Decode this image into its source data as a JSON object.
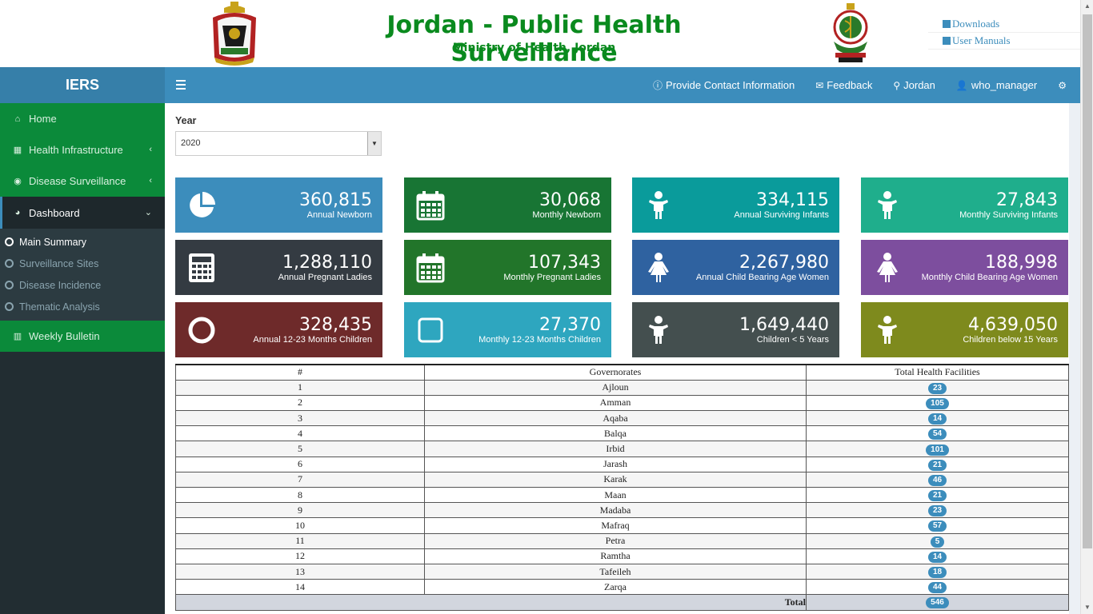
{
  "header": {
    "title": "Jordan - Public Health Surveillance",
    "subtitle": "Ministry of Health, Jordan",
    "links": [
      "Downloads",
      "User Manuals"
    ]
  },
  "brand": "IERS",
  "navbar": {
    "items": [
      {
        "icon": "info-icon",
        "label": "Provide Contact Information"
      },
      {
        "icon": "envelope-icon",
        "label": "Feedback"
      },
      {
        "icon": "map-marker-icon",
        "label": "Jordan"
      },
      {
        "icon": "user-icon",
        "label": "who_manager"
      }
    ]
  },
  "sidebar": {
    "items": [
      {
        "label": "Home",
        "icon": "home-icon"
      },
      {
        "label": "Health Infrastructure",
        "icon": "grid-icon"
      },
      {
        "label": "Disease Surveillance",
        "icon": "eye-icon"
      },
      {
        "label": "Dashboard",
        "icon": "pie-chart-icon"
      },
      {
        "label": "Weekly Bulletin",
        "icon": "bar-chart-icon"
      }
    ],
    "submenu": [
      "Main Summary",
      "Surveillance Sites",
      "Disease Incidence",
      "Thematic Analysis"
    ]
  },
  "filter": {
    "label": "Year",
    "selected": "2020"
  },
  "tiles": [
    {
      "value": "360,815",
      "label": "Annual Newborn",
      "color": "#3c8dbc",
      "icon": "pie-chart-icon"
    },
    {
      "value": "30,068",
      "label": "Monthly Newborn",
      "color": "#187534",
      "icon": "calendar-icon"
    },
    {
      "value": "334,115",
      "label": "Annual Surviving Infants",
      "color": "#0a9b9b",
      "icon": "child-icon"
    },
    {
      "value": "27,843",
      "label": "Monthly Surviving Infants",
      "color": "#1fae8c",
      "icon": "child-icon"
    },
    {
      "value": "1,288,110",
      "label": "Annual Pregnant Ladies",
      "color": "#343b42",
      "icon": "calculator-icon"
    },
    {
      "value": "107,343",
      "label": "Monthly Pregnant Ladies",
      "color": "#22752a",
      "icon": "calendar-icon"
    },
    {
      "value": "2,267,980",
      "label": "Annual Child Bearing Age Women",
      "color": "#2f62a0",
      "icon": "female-icon"
    },
    {
      "value": "188,998",
      "label": "Monthly Child Bearing Age Women",
      "color": "#7d4e9e",
      "icon": "female-icon"
    },
    {
      "value": "328,435",
      "label": "Annual 12-23 Months Children",
      "color": "#6e2a2a",
      "icon": "circle-icon"
    },
    {
      "value": "27,370",
      "label": "Monthly 12-23 Months Children",
      "color": "#2ea6bf",
      "icon": "square-icon"
    },
    {
      "value": "1,649,440",
      "label": "Children < 5 Years",
      "color": "#444f4f",
      "icon": "child-icon"
    },
    {
      "value": "4,639,050",
      "label": "Children below 15 Years",
      "color": "#7e8a1d",
      "icon": "child-icon"
    }
  ],
  "table": {
    "headers": [
      "#",
      "Governorates",
      "Total Health Facilities"
    ],
    "rows": [
      [
        "1",
        "Ajloun",
        "23"
      ],
      [
        "2",
        "Amman",
        "105"
      ],
      [
        "3",
        "Aqaba",
        "14"
      ],
      [
        "4",
        "Balqa",
        "54"
      ],
      [
        "5",
        "Irbid",
        "101"
      ],
      [
        "6",
        "Jarash",
        "21"
      ],
      [
        "7",
        "Karak",
        "46"
      ],
      [
        "8",
        "Maan",
        "21"
      ],
      [
        "9",
        "Madaba",
        "23"
      ],
      [
        "10",
        "Mafraq",
        "57"
      ],
      [
        "11",
        "Petra",
        "5"
      ],
      [
        "12",
        "Ramtha",
        "14"
      ],
      [
        "13",
        "Tafeileh",
        "18"
      ],
      [
        "14",
        "Zarqa",
        "44"
      ]
    ],
    "total_label": "Total",
    "total_value": "546"
  }
}
